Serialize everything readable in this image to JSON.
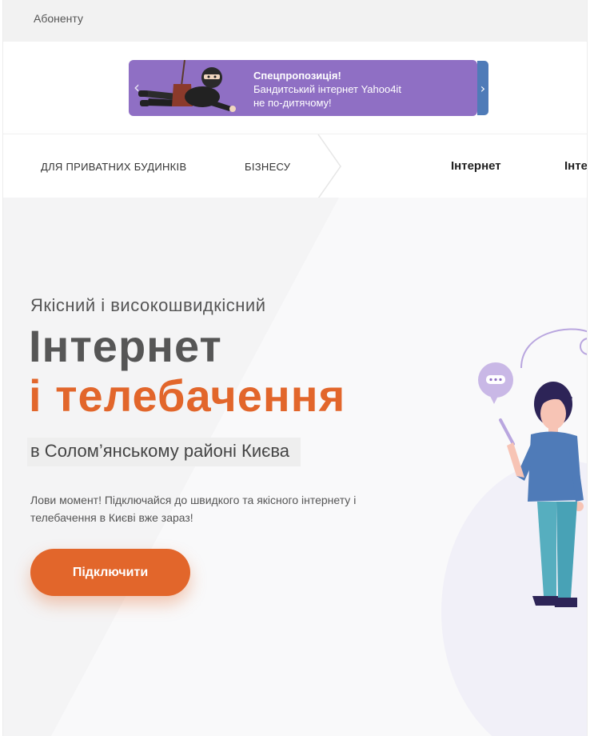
{
  "topbar": {
    "subscriber_link": "Абоненту"
  },
  "promo": {
    "headline": "Спецпропозиція!",
    "line1": "Бандитський інтернет Yahoo4it",
    "line2": "не по-дитячому!",
    "prev_icon": "‹",
    "next_icon": "›"
  },
  "nav": {
    "tabs": [
      "ДЛЯ ПРИВАТНИХ БУДИНКІВ",
      "БІЗНЕСУ"
    ],
    "services": [
      "Інтернет",
      "Інте"
    ]
  },
  "hero": {
    "subtitle": "Якісний і високошвидкісний",
    "title_line1": "Інтернет",
    "title_line2": "і телебачення",
    "location": "в Солом’янському районі Києва",
    "description": "Лови момент! Підключайся до швидкого та якісного інтернету і телебачення в Києві вже зараз!",
    "cta_label": "Підключити"
  },
  "colors": {
    "accent": "#e2662b",
    "promo_bg": "#8f6fc4",
    "promo_next": "#4f7bb8",
    "title_dark": "#565656"
  }
}
